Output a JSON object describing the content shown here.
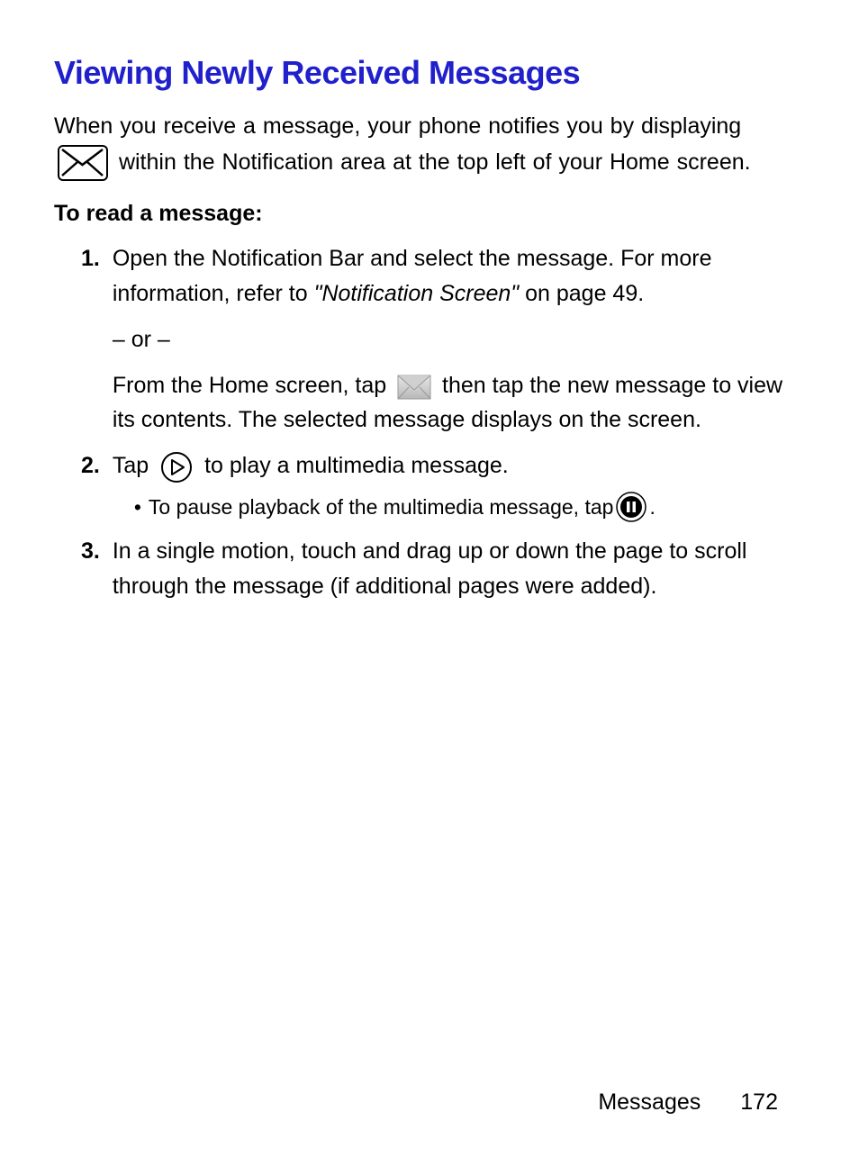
{
  "title": "Viewing Newly Received Messages",
  "intro": {
    "part1": "When you receive a message, your phone notifies you by displaying ",
    "part2": " within the Notification area at the top left of your Home screen."
  },
  "subheading": "To read a message:",
  "steps": [
    {
      "number": "1.",
      "text1": "Open the Notification Bar and select the message. For more information, refer to ",
      "ref": "\"Notification Screen\" ",
      "ref_suffix": " on page 49.",
      "or": "– or –",
      "text2a": "From the Home screen, tap ",
      "text2b": " then tap the new message to view its contents. The selected message displays on the screen."
    },
    {
      "number": "2.",
      "text_a": "Tap ",
      "text_b": " to play a multimedia message.",
      "bullet_a": "To pause playback of the multimedia message, tap ",
      "bullet_b": "."
    },
    {
      "number": "3.",
      "text": "In a single motion, touch and drag up or down the page to scroll through the message (if additional pages were added)."
    }
  ],
  "footer": {
    "section": "Messages",
    "page": "172"
  }
}
